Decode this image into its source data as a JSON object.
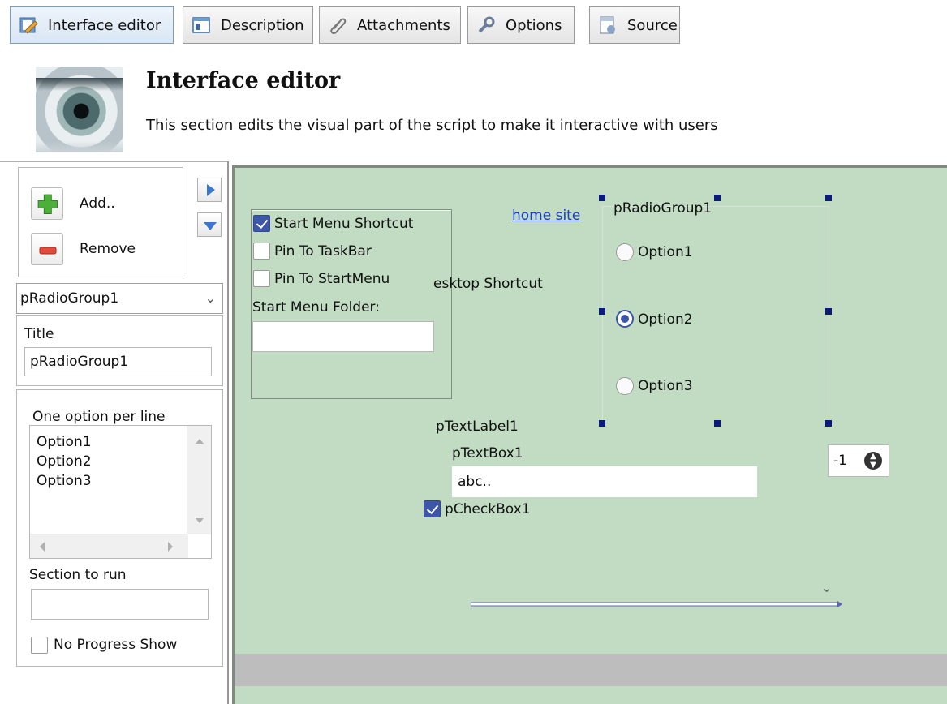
{
  "toolbar": {
    "tabs": [
      {
        "label": "Interface editor",
        "icon": "pencil-edit-icon",
        "active": true
      },
      {
        "label": "Description",
        "icon": "window-icon"
      },
      {
        "label": "Attachments",
        "icon": "paperclip-icon"
      },
      {
        "label": "Options",
        "icon": "wrench-icon"
      },
      {
        "label": "Source",
        "icon": "script-source-icon"
      }
    ]
  },
  "header": {
    "title": "Interface editor",
    "subtitle": "This section edits the visual part of the script to make it interactive with users",
    "image": "eye-logo"
  },
  "left_panel": {
    "add_label": "Add..",
    "remove_label": "Remove",
    "selected_component": "pRadioGroup1",
    "title_label": "Title",
    "title_value": "pRadioGroup1",
    "options_label": "One option per line",
    "options_lines": [
      "Option1",
      "Option2",
      "Option3"
    ],
    "section_to_run_label": "Section to run",
    "section_to_run_value": "",
    "no_progress_label": "No Progress Show",
    "no_progress_checked": false
  },
  "canvas": {
    "background": "#c1dcc3",
    "checkboxes": [
      {
        "label": "Start Menu Shortcut",
        "checked": true
      },
      {
        "label": "Pin To TaskBar",
        "checked": false
      },
      {
        "label": "Pin To StartMenu",
        "checked": false
      }
    ],
    "start_menu_folder_label": "Start Menu Folder:",
    "start_menu_folder_value": "",
    "desktop_shortcut_label": "esktop Shortcut",
    "home_link": "home site",
    "radio_group": {
      "title": "pRadioGroup1",
      "options": [
        {
          "label": "Option1",
          "selected": false
        },
        {
          "label": "Option2",
          "selected": true
        },
        {
          "label": "Option3",
          "selected": false
        }
      ]
    },
    "text_label": "pTextLabel1",
    "text_box_label": "pTextBox1",
    "text_box_value": "abc..",
    "check_box": {
      "label": "pCheckBox1",
      "checked": true
    },
    "spin_value": "-1"
  }
}
